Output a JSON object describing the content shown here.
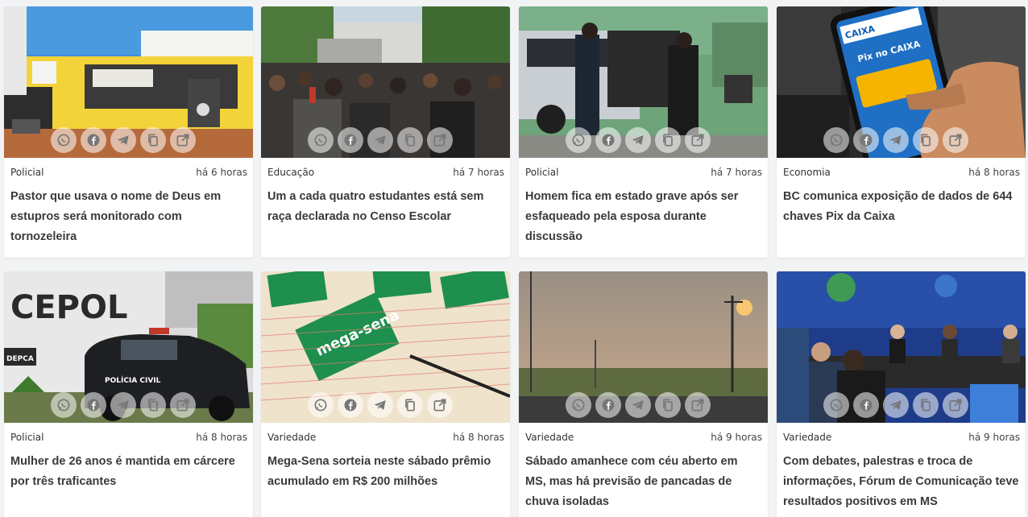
{
  "share_icons": [
    "whatsapp-icon",
    "facebook-icon",
    "telegram-icon",
    "copy-link-icon",
    "open-external-icon"
  ],
  "cards": [
    {
      "category": "Policial",
      "time": "há 6 horas",
      "title": "Pastor que usava o nome de Deus em estupros será monitorado com tornozeleira"
    },
    {
      "category": "Educação",
      "time": "há 7 horas",
      "title": "Um a cada quatro estudantes está sem raça declarada no Censo Escolar"
    },
    {
      "category": "Policial",
      "time": "há 7 horas",
      "title": "Homem fica em estado grave após ser esfaqueado pela esposa durante discussão"
    },
    {
      "category": "Economia",
      "time": "há 8 horas",
      "title": "BC comunica exposição de dados de 644 chaves Pix da Caixa"
    },
    {
      "category": "Policial",
      "time": "há 8 horas",
      "title": "Mulher de 26 anos é mantida em cárcere por três traficantes"
    },
    {
      "category": "Variedade",
      "time": "há 8 horas",
      "title": "Mega-Sena sorteia neste sábado prêmio acumulado em R$ 200 milhões"
    },
    {
      "category": "Variedade",
      "time": "há 9 horas",
      "title": "Sábado amanhece com céu aberto em MS, mas há previsão de pancadas de chuva isoladas"
    },
    {
      "category": "Variedade",
      "time": "há 9 horas",
      "title": "Com debates, palestras e troca de informações, Fórum de Comunicação teve resultados positivos em MS"
    }
  ],
  "image_text": {
    "cepol": "CEPOL",
    "depca": "DEPCA",
    "policia_civil": "POLÍCIA CIVIL",
    "mega_sena": "mega-sena",
    "caixa": "CAIXA",
    "pix_caixa": "Pix no CAIXA"
  }
}
